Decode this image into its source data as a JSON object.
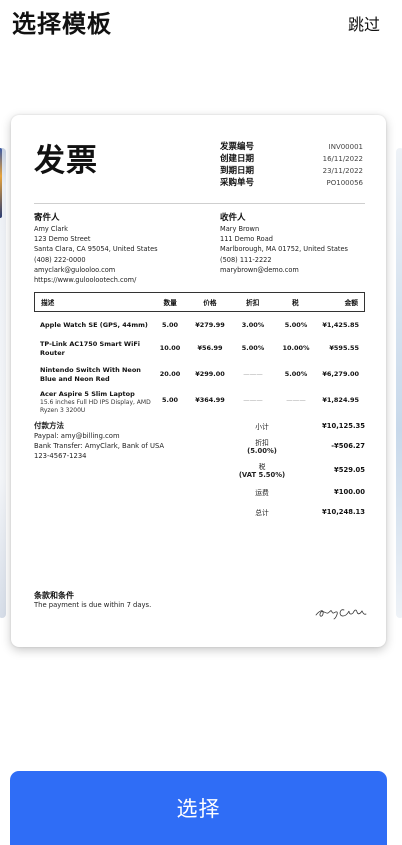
{
  "header": {
    "title": "选择模板",
    "skip_label": "跳过"
  },
  "invoice": {
    "title": "发票",
    "meta": [
      {
        "label": "发票编号",
        "value": "INV00001"
      },
      {
        "label": "创建日期",
        "value": "16/11/2022"
      },
      {
        "label": "到期日期",
        "value": "23/11/2022"
      },
      {
        "label": "采购单号",
        "value": "PO100056"
      }
    ],
    "from": {
      "heading": "寄件人",
      "lines": [
        "Amy Clark",
        "123 Demo Street",
        "Santa Clara, CA 95054, United States",
        "(408) 222-0000",
        "amyclark@gulooloo.com",
        "https://www.guloolootech.com/"
      ]
    },
    "to": {
      "heading": "收件人",
      "lines": [
        "Mary Brown",
        "111 Demo Road",
        "Marlborough, MA 01752, United States",
        "(508) 111-2222",
        "marybrown@demo.com"
      ]
    },
    "table": {
      "headers": {
        "desc": "描述",
        "qty": "数量",
        "price": "价格",
        "disc": "折扣",
        "tax": "税",
        "amt": "金额"
      },
      "rows": [
        {
          "name": "Apple Watch SE (GPS, 44mm)",
          "sub": "",
          "qty": "5.00",
          "price": "¥279.99",
          "disc": "3.00%",
          "tax": "5.00%",
          "amt": "¥1,425.85"
        },
        {
          "name": "TP-Link AC1750 Smart WiFi Router",
          "sub": "",
          "qty": "10.00",
          "price": "¥56.99",
          "disc": "5.00%",
          "tax": "10.00%",
          "amt": "¥595.55"
        },
        {
          "name": "Nintendo Switch With Neon Blue and Neon Red",
          "sub": "",
          "qty": "20.00",
          "price": "¥299.00",
          "disc": "———",
          "tax": "5.00%",
          "amt": "¥6,279.00"
        },
        {
          "name": "Acer Aspire 5 Slim Laptop",
          "sub": "15.6 inches Full HD IPS Display, AMD Ryzen 3 3200U",
          "qty": "5.00",
          "price": "¥364.99",
          "disc": "———",
          "tax": "———",
          "amt": "¥1,824.95"
        }
      ]
    },
    "payment": {
      "heading": "付款方法",
      "lines": [
        "Paypal: amy@billing.com",
        "Bank Transfer: AmyClark, Bank of USA",
        "123-4567-1234"
      ]
    },
    "totals": [
      {
        "label": "小计",
        "sub": "",
        "value": "¥10,125.35"
      },
      {
        "label": "折扣",
        "sub": "(5.00%)",
        "value": "-¥506.27"
      },
      {
        "label": "税",
        "sub": "(VAT 5.50%)",
        "value": "¥529.05"
      },
      {
        "label": "运费",
        "sub": "",
        "value": "¥100.00"
      },
      {
        "label": "总计",
        "sub": "",
        "value": "¥10,248.13"
      }
    ],
    "terms": {
      "heading": "条款和条件",
      "text": "The payment is due within 7 days."
    }
  },
  "select_button": {
    "label": "选择"
  }
}
